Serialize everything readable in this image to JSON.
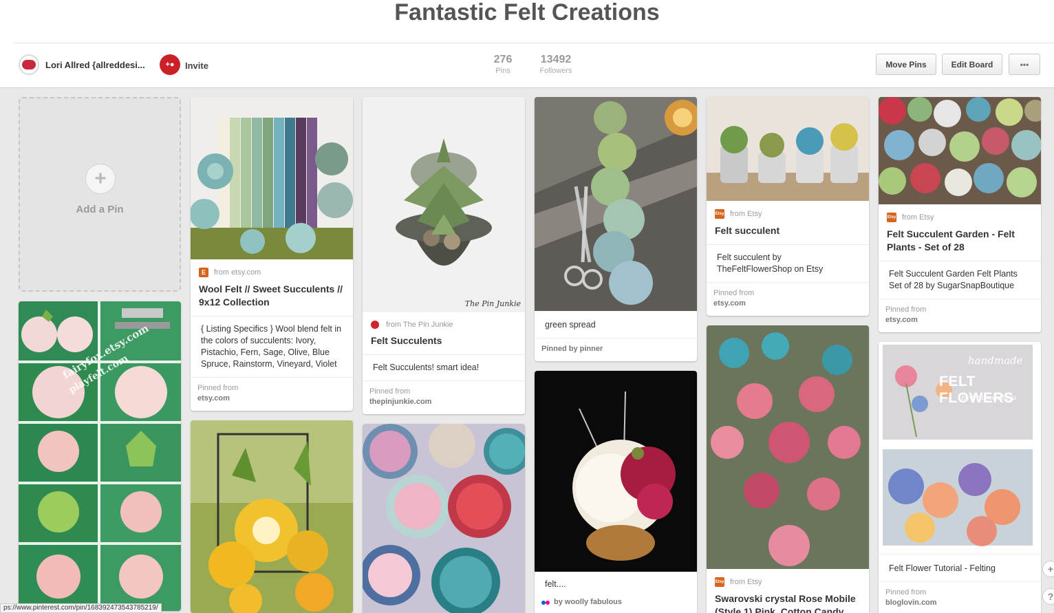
{
  "board": {
    "title": "Fantastic Felt Creations",
    "owner_name": "Lori Allred {allreddesi...",
    "invite_label": "Invite",
    "invite_icon_text": "+"
  },
  "stats": [
    {
      "num": "276",
      "label": "Pins"
    },
    {
      "num": "13492",
      "label": "Followers"
    }
  ],
  "actions": {
    "move_pins": "Move Pins",
    "edit_board": "Edit Board",
    "more": "•••"
  },
  "add_pin": {
    "icon": "+",
    "label": "Add a Pin"
  },
  "pins": {
    "wool": {
      "source_icon": "E",
      "source": "from etsy.com",
      "title": "Wool Felt // Sweet Succulents // 9x12 Collection",
      "description": "{ Listing Specifics } Wool blend felt in the colors of succulents: Ivory, Pistachio, Fern, Sage, Olive, Blue Spruce, Rainstorm, Vineyard, Violet",
      "pinned_label": "Pinned from",
      "pinned_from": "etsy.com"
    },
    "pinjunkie": {
      "source": "from The Pin Junkie",
      "title": "Felt Succulents",
      "description": "Felt Succulents! smart idea!",
      "pinned_label": "Pinned from",
      "pinned_from": "thepinjunkie.com",
      "watermark": "The Pin Junkie"
    },
    "green": {
      "description": "green spread",
      "pinned_by": "Pinned by pinner"
    },
    "felt4": {
      "description": "felt....",
      "by": "by woolly fabulous"
    },
    "succulent": {
      "source_icon": "Etsy",
      "source": "from Etsy",
      "title": "Felt succulent",
      "description": "Felt succulent by TheFeltFlowerShop on Etsy",
      "pinned_label": "Pinned from",
      "pinned_from": "etsy.com"
    },
    "rose": {
      "source_icon": "Etsy",
      "source": "from Etsy",
      "title": "Swarovski crystal Rose Mobile (Style 1) Pink, Cotton Candy"
    },
    "garden": {
      "source_icon": "Etsy",
      "source": "from Etsy",
      "title": "Felt Succulent Garden - Felt Plants - Set of 28",
      "description": "Felt Succulent Garden Felt Plants Set of 28 by SugarSnapBoutique",
      "pinned_label": "Pinned from",
      "pinned_from": "etsy.com"
    },
    "flowers": {
      "overlay_small": "handmade",
      "overlay_big": "FELT FLOWERS",
      "overlay_by": "by bruyuevdaya",
      "description": "Felt Flower Tutorial - Felting",
      "pinned_label": "Pinned from",
      "pinned_from": "bloglovin.com"
    },
    "tutorial": {
      "watermark1": "fairyfox.etsy.com",
      "watermark2": "playfelt.com"
    }
  },
  "status_url": "ps://www.pinterest.com/pin/168392473543785219/",
  "side_buttons": [
    "+",
    "?"
  ]
}
